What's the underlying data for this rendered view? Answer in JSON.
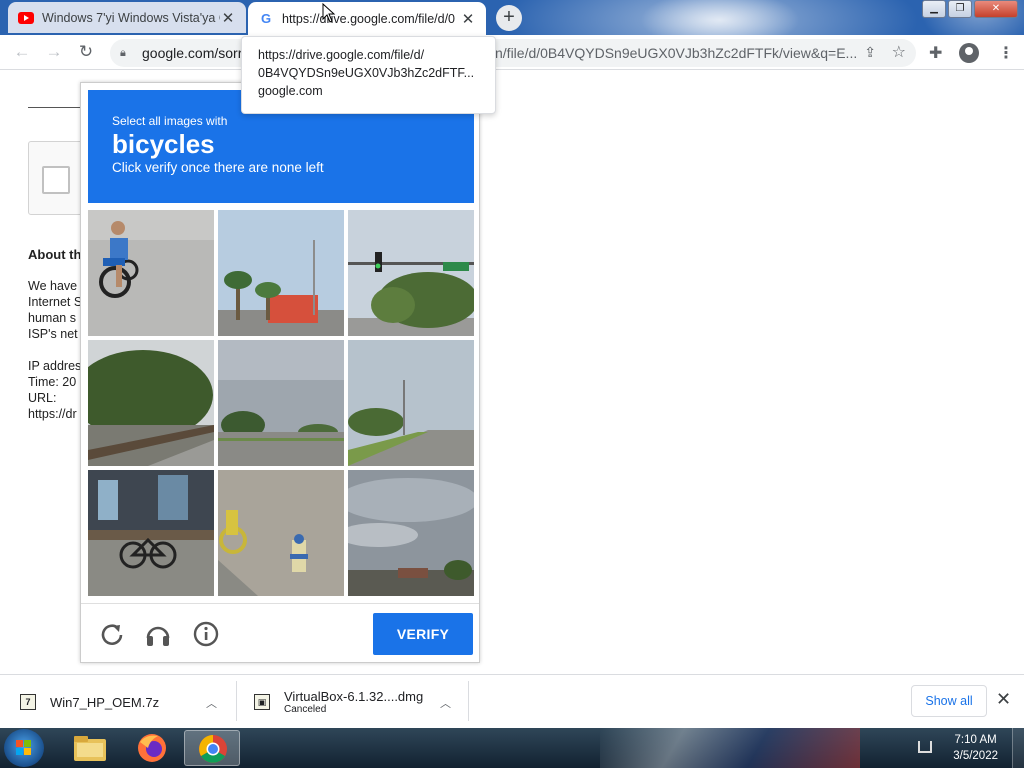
{
  "browser": {
    "tabs": [
      {
        "title": "Windows 7'yi Windows Vista'ya G",
        "favicon": "youtube-icon",
        "active": false
      },
      {
        "title": "https://drive.google.com/file/d/0",
        "favicon": "google-icon",
        "active": true
      }
    ],
    "address": {
      "url": "google.com/sorr",
      "url_tail": "n/file/d/0B4VQYDSn9eUGX0VJb3hZc2dFTFk/view&q=E..."
    },
    "tooltip": {
      "line1": "https://drive.google.com/file/d/",
      "line2": "0B4VQYDSn9eUGX0VJb3hZc2dFTF...",
      "line3": "google.com"
    }
  },
  "page": {
    "about_heading": "About th",
    "lines": [
      "We have",
      "Internet S",
      "human s",
      "ISP's net",
      "",
      "IP addres",
      "Time: 20",
      "URL:",
      "https://dr"
    ]
  },
  "captcha": {
    "instruction_small": "Select all images with",
    "instruction_big": "bicycles",
    "instruction_sub": "Click verify once there are none left",
    "verify_label": "VERIFY",
    "accent_color": "#1a73e8",
    "tiles": [
      "cyclist-on-bicycle",
      "palm-trees-street",
      "traffic-light-intersection",
      "trees-road-fence",
      "cloudy-road",
      "highway-trees",
      "bicycle-near-building",
      "bicycle-fire-hydrant",
      "cloudy-sky-street"
    ]
  },
  "downloads": {
    "items": [
      {
        "name": "Win7_HP_OEM.7z",
        "status": ""
      },
      {
        "name": "VirtualBox-6.1.32....dmg",
        "status": "Canceled"
      }
    ],
    "show_all": "Show all"
  },
  "taskbar": {
    "time": "7:10 AM",
    "date": "3/5/2022"
  }
}
